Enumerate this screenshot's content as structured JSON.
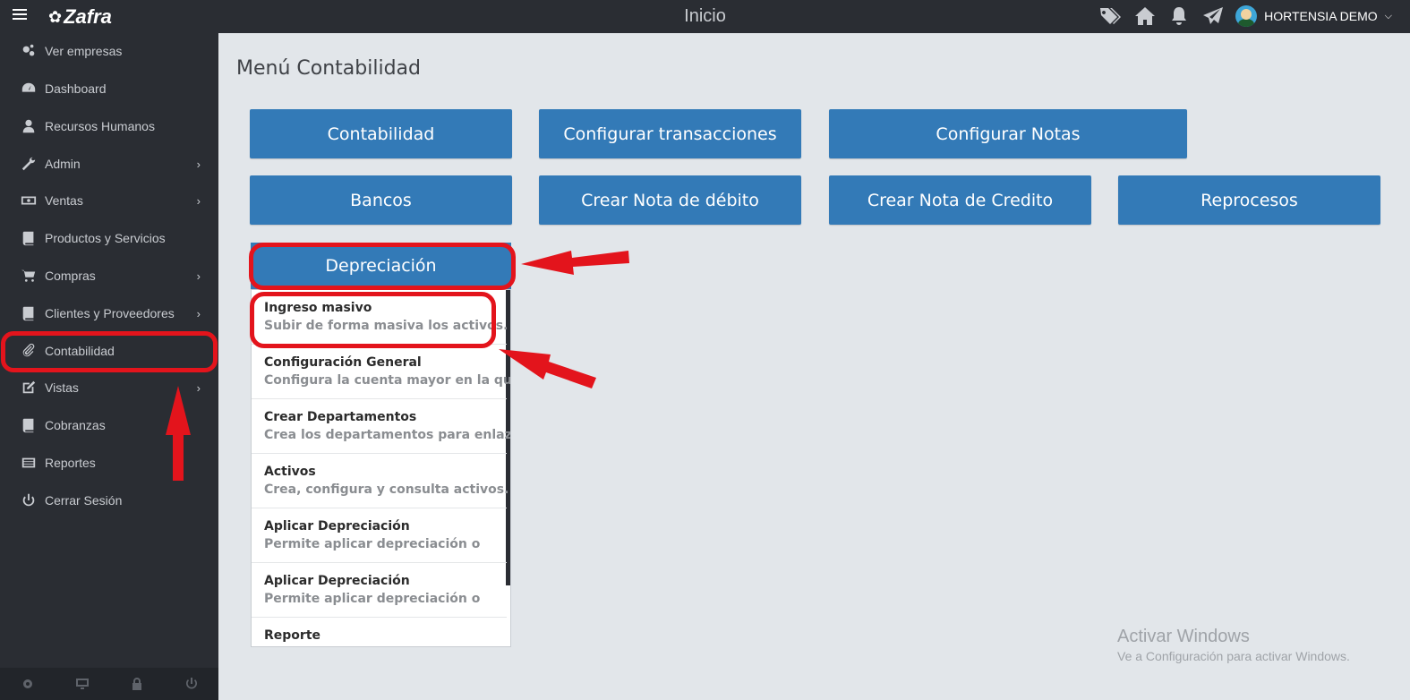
{
  "app": {
    "logo": "Zafra",
    "page_title": "Inicio"
  },
  "user": {
    "name": "HORTENSIA DEMO"
  },
  "topbar_icons": [
    "tags-icon",
    "home-icon",
    "bell-icon",
    "paper-plane-icon"
  ],
  "sidebar": {
    "items": [
      {
        "label": "Ver empresas",
        "icon": "gears-icon",
        "has_arrow": false
      },
      {
        "label": "Dashboard",
        "icon": "dashboard-icon",
        "has_arrow": false
      },
      {
        "label": "Recursos Humanos",
        "icon": "user-icon",
        "has_arrow": false
      },
      {
        "label": "Admin",
        "icon": "wrench-icon",
        "has_arrow": true
      },
      {
        "label": "Ventas",
        "icon": "money-icon",
        "has_arrow": true
      },
      {
        "label": "Productos y Servicios",
        "icon": "book-icon",
        "has_arrow": false
      },
      {
        "label": "Compras",
        "icon": "cart-icon",
        "has_arrow": true
      },
      {
        "label": "Clientes y Proveedores",
        "icon": "book-icon",
        "has_arrow": true
      },
      {
        "label": "Contabilidad",
        "icon": "paperclip-icon",
        "has_arrow": false
      },
      {
        "label": "Vistas",
        "icon": "edit-icon",
        "has_arrow": true
      },
      {
        "label": "Cobranzas",
        "icon": "book-icon",
        "has_arrow": false
      },
      {
        "label": "Reportes",
        "icon": "list-icon",
        "has_arrow": false
      },
      {
        "label": "Cerrar Sesión",
        "icon": "power-icon",
        "has_arrow": false
      }
    ],
    "footer_icons": [
      "gear-icon",
      "monitor-icon",
      "lock-icon",
      "power-icon"
    ]
  },
  "main": {
    "title": "Menú Contabilidad",
    "buttons_row1": [
      "Contabilidad",
      "Configurar transacciones",
      "Configurar Notas"
    ],
    "buttons_row2": [
      "Bancos",
      "Crear Nota de débito",
      "Crear Nota de Credito",
      "Reprocesos"
    ],
    "dropdown": {
      "label": "Depreciación",
      "items": [
        {
          "title": "Ingreso masivo",
          "desc": "Subir de forma masiva los activos."
        },
        {
          "title": "Configuración General",
          "desc": "Configura la cuenta mayor en la que"
        },
        {
          "title": "Crear Departamentos",
          "desc": "Crea los departamentos para enlazar"
        },
        {
          "title": "Activos",
          "desc": "Crea, configura y consulta activos."
        },
        {
          "title": "Aplicar Depreciación",
          "desc": "Permite aplicar depreciación o"
        },
        {
          "title": "Aplicar Depreciación",
          "desc": "Permite aplicar depreciación o"
        },
        {
          "title": "Reporte",
          "desc": ""
        }
      ]
    }
  },
  "watermark": {
    "line1": "Activar Windows",
    "line2": "Ve a Configuración para activar Windows."
  },
  "colors": {
    "topbar": "#2a2d33",
    "accent": "#337ab7",
    "annotation": "#e3141c",
    "background": "#e2e6ea"
  }
}
